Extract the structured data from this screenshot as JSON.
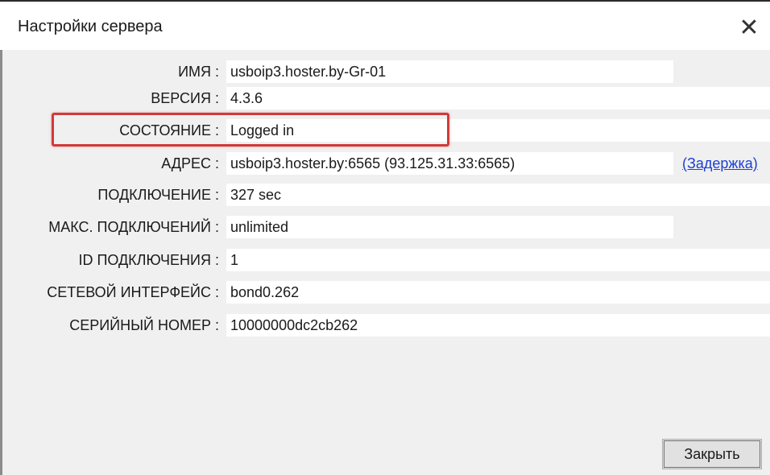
{
  "window": {
    "title": "Настройки сервера",
    "close_glyph": "✕"
  },
  "fields": [
    {
      "label": "ИМЯ :",
      "value": "usboip3.hoster.by-Gr-01"
    },
    {
      "label": "ВЕРСИЯ :",
      "value": "4.3.6"
    },
    {
      "label": "СОСТОЯНИЕ :",
      "value": "Logged in"
    },
    {
      "label": "АДРЕС :",
      "value": "usboip3.hoster.by:6565 (93.125.31.33:6565)"
    },
    {
      "label": "ПОДКЛЮЧЕНИЕ :",
      "value": "327 sec"
    },
    {
      "label": "МАКС. ПОДКЛЮЧЕНИЙ :",
      "value": "unlimited"
    },
    {
      "label": "ID ПОДКЛЮЧЕНИЯ :",
      "value": "1"
    },
    {
      "label": "СЕТЕВОЙ ИНТЕРФЕЙС :",
      "value": "bond0.262"
    },
    {
      "label": "СЕРИЙНЫЙ НОМЕР :",
      "value": "10000000dc2cb262"
    }
  ],
  "links": {
    "delay": "(Задержка)"
  },
  "buttons": {
    "close_label": "Закрыть"
  },
  "colors": {
    "highlight": "#d23a3a",
    "link": "#1c3fd1"
  }
}
